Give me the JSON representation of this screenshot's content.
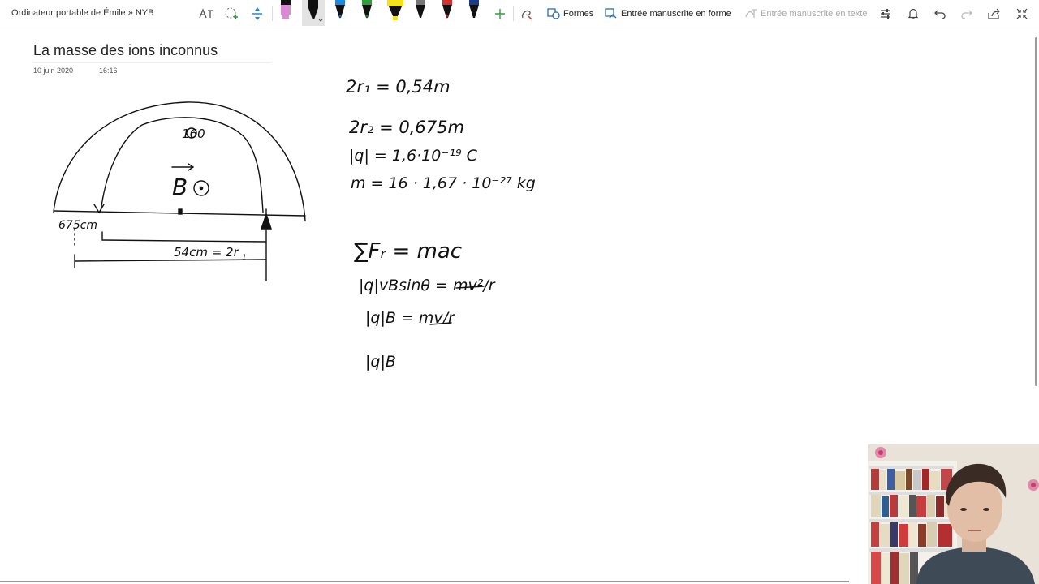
{
  "toolbar": {
    "breadcrumb": "Ordinateur portable de Émile » NYB",
    "shapes_label": "Formes",
    "ink_to_shape_label": "Entrée manuscrite en forme",
    "ink_to_text_label": "Entrée manuscrite en texte",
    "pens": [
      {
        "name": "pink-highlighter",
        "color": "#d98ad3"
      },
      {
        "name": "black-pen",
        "color": "#111111"
      },
      {
        "name": "blue-pen",
        "color": "#1e88e5"
      },
      {
        "name": "green-pen",
        "color": "#2e9e3a"
      },
      {
        "name": "yellow-highlighter",
        "color": "#f5e11a"
      },
      {
        "name": "dark-pen",
        "color": "#333333"
      },
      {
        "name": "red-pen",
        "color": "#d32f2f"
      },
      {
        "name": "navy-pen",
        "color": "#1a3a8a"
      }
    ],
    "accent_color": "#2b6cb0"
  },
  "page": {
    "title": "La masse des ions inconnus",
    "date": "10 juin 2020",
    "time": "16:16"
  },
  "ink": {
    "diagram_labels": {
      "angle": "160",
      "field": "B",
      "left_distance": "675cm",
      "distance": "54cm = 2r",
      "distance_sub": "1"
    },
    "equations_top": [
      "2r₁ = 0,54m",
      "2r₂ = 0,675m",
      "|q| = 1,6·10⁻¹⁹ C",
      "m = 16 · 1,67 · 10⁻²⁷ kg"
    ],
    "equations_bottom": [
      "∑Fᵣ = maᴄ",
      "|q|vBsinθ = mv²/r",
      "|q|B = mv/r",
      "|q|B"
    ]
  }
}
